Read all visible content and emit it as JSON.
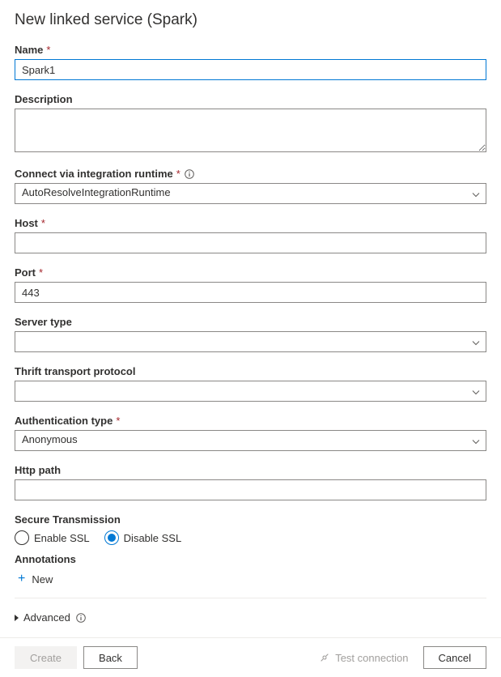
{
  "title": "New linked service (Spark)",
  "fields": {
    "name": {
      "label": "Name",
      "value": "Spark1",
      "required": true
    },
    "description": {
      "label": "Description",
      "value": ""
    },
    "runtime": {
      "label": "Connect via integration runtime",
      "value": "AutoResolveIntegrationRuntime",
      "required": true,
      "info": true
    },
    "host": {
      "label": "Host",
      "value": "",
      "required": true
    },
    "port": {
      "label": "Port",
      "value": "443",
      "required": true
    },
    "serverType": {
      "label": "Server type",
      "value": ""
    },
    "thrift": {
      "label": "Thrift transport protocol",
      "value": ""
    },
    "authType": {
      "label": "Authentication type",
      "value": "Anonymous",
      "required": true
    },
    "httpPath": {
      "label": "Http path",
      "value": ""
    }
  },
  "secureTransmission": {
    "label": "Secure Transmission",
    "options": {
      "enable": "Enable SSL",
      "disable": "Disable SSL"
    },
    "selected": "disable"
  },
  "annotations": {
    "label": "Annotations",
    "newLabel": "New"
  },
  "advanced": {
    "label": "Advanced",
    "info": true
  },
  "footer": {
    "create": "Create",
    "back": "Back",
    "testConnection": "Test connection",
    "cancel": "Cancel"
  }
}
